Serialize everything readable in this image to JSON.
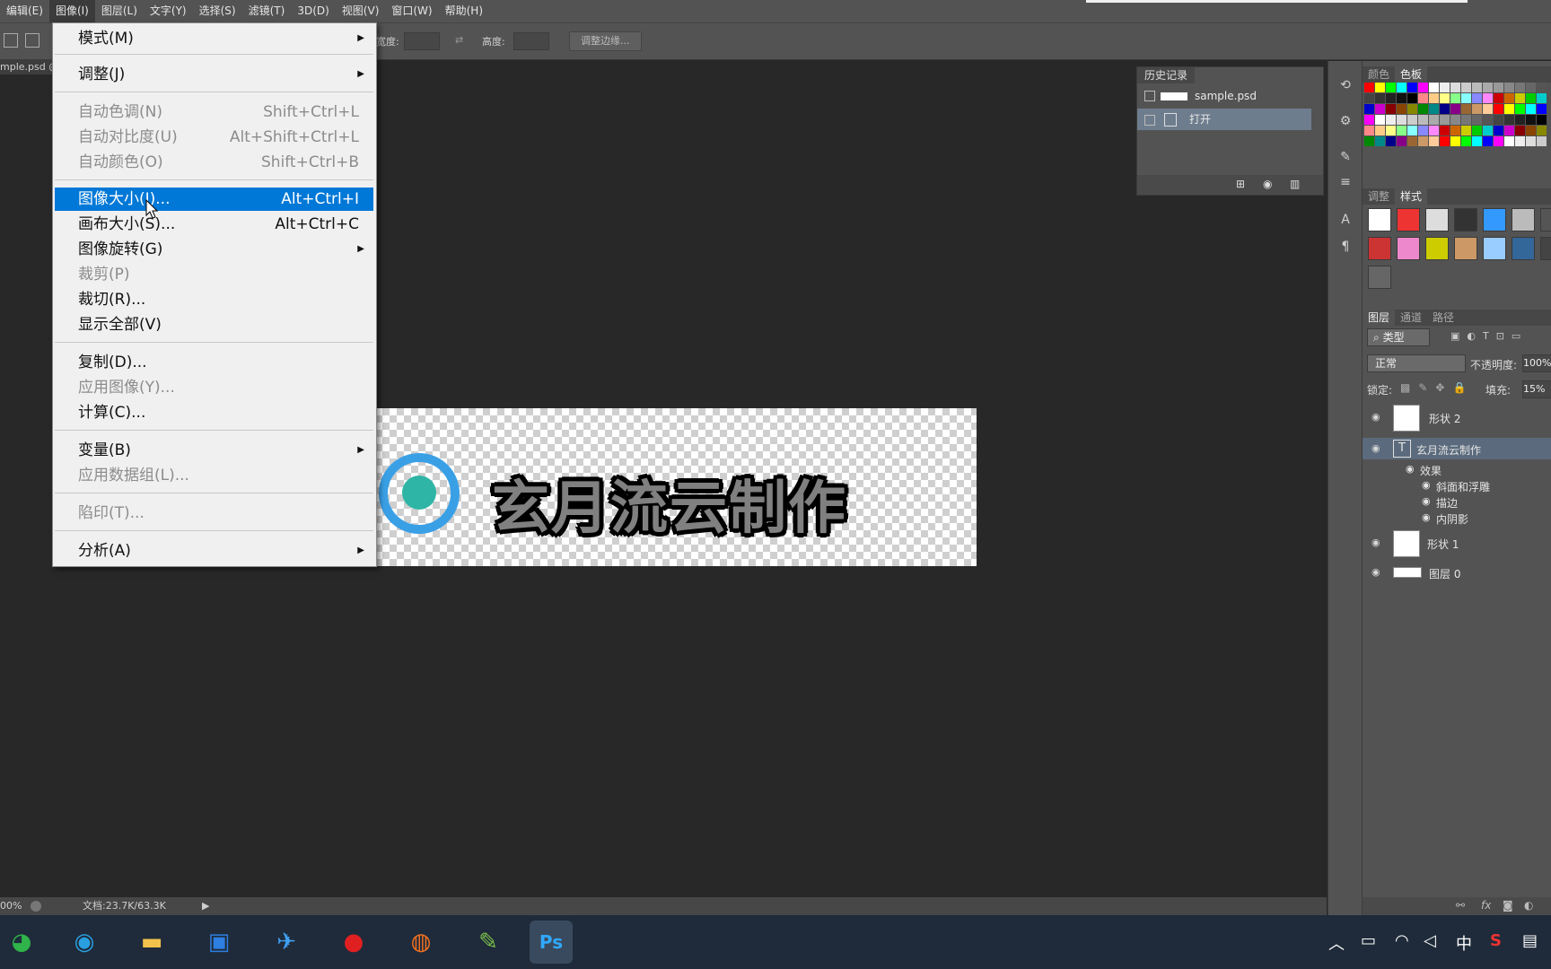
{
  "menubar": {
    "items": [
      "编辑(E)",
      "图像(I)",
      "图层(L)",
      "文字(Y)",
      "选择(S)",
      "滤镜(T)",
      "3D(D)",
      "视图(V)",
      "窗口(W)",
      "帮助(H)"
    ]
  },
  "options": {
    "width_label": "宽度:",
    "height_label": "高度:",
    "refine_button": "调整边缘..."
  },
  "doc_tab": "mple.psd @",
  "image_menu": {
    "items": [
      {
        "label": "模式(M)",
        "shortcut": "",
        "submenu": true,
        "disabled": false
      },
      {
        "label": "调整(J)",
        "shortcut": "",
        "submenu": true,
        "disabled": false
      },
      {
        "label": "自动色调(N)",
        "shortcut": "Shift+Ctrl+L",
        "disabled": true
      },
      {
        "label": "自动对比度(U)",
        "shortcut": "Alt+Shift+Ctrl+L",
        "disabled": true
      },
      {
        "label": "自动颜色(O)",
        "shortcut": "Shift+Ctrl+B",
        "disabled": true
      },
      {
        "label": "图像大小(I)...",
        "shortcut": "Alt+Ctrl+I",
        "highlighted": true
      },
      {
        "label": "画布大小(S)...",
        "shortcut": "Alt+Ctrl+C"
      },
      {
        "label": "图像旋转(G)",
        "shortcut": "",
        "submenu": true
      },
      {
        "label": "裁剪(P)",
        "shortcut": "",
        "disabled": true
      },
      {
        "label": "裁切(R)...",
        "shortcut": ""
      },
      {
        "label": "显示全部(V)",
        "shortcut": ""
      },
      {
        "label": "复制(D)...",
        "shortcut": ""
      },
      {
        "label": "应用图像(Y)...",
        "shortcut": "",
        "disabled": true
      },
      {
        "label": "计算(C)...",
        "shortcut": ""
      },
      {
        "label": "变量(B)",
        "shortcut": "",
        "submenu": true
      },
      {
        "label": "应用数据组(L)...",
        "shortcut": "",
        "disabled": true
      },
      {
        "label": "陷印(T)...",
        "shortcut": "",
        "disabled": true
      },
      {
        "label": "分析(A)",
        "shortcut": "",
        "submenu": true
      }
    ]
  },
  "canvas": {
    "logo_text": "玄月流云制作"
  },
  "history": {
    "tab": "历史记录",
    "snapshot": "sample.psd",
    "step": "打开"
  },
  "color_panel": {
    "tabs": [
      "颜色",
      "色板"
    ]
  },
  "adjust_panel": {
    "tabs": [
      "调整",
      "样式"
    ]
  },
  "layers_panel": {
    "tabs": [
      "图层",
      "通道",
      "路径"
    ],
    "filter_kind": "类型",
    "blend_mode": "正常",
    "opacity_label": "不透明度:",
    "opacity_value": "100%",
    "lock_label": "锁定:",
    "fill_label": "填充:",
    "fill_value": "15%",
    "layers": [
      {
        "name": "形状 2"
      },
      {
        "name": "玄月流云制作"
      },
      {
        "name": "效果"
      },
      {
        "name": "斜面和浮雕"
      },
      {
        "name": "描边"
      },
      {
        "name": "内阴影"
      },
      {
        "name": "形状 1"
      },
      {
        "name": "图层 0"
      }
    ]
  },
  "status": {
    "zoom": "00%",
    "doc": "文档:23.7K/63.3K"
  },
  "tray": {
    "ime": "中"
  }
}
